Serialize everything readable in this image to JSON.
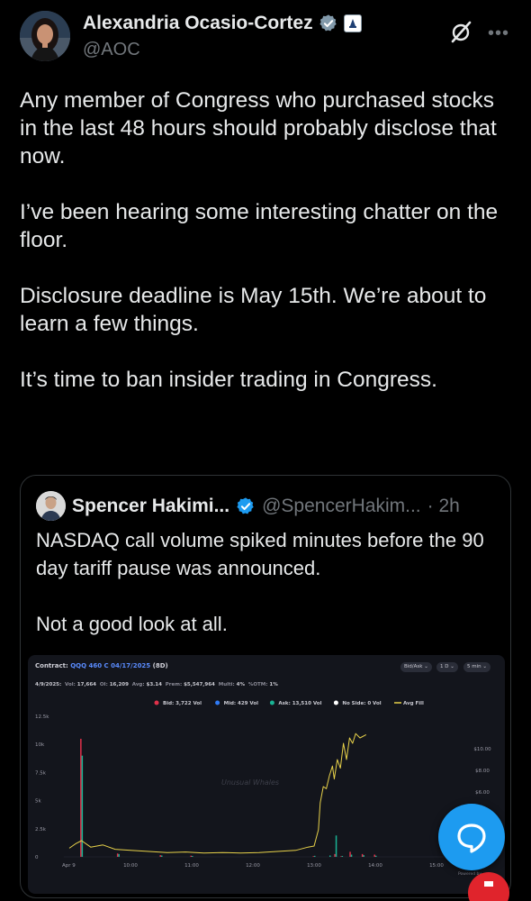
{
  "author": {
    "name": "Alexandria Ocasio-Cortez",
    "handle": "@AOC"
  },
  "tweet": {
    "paragraphs": [
      "Any member of Congress who purchased stocks in the last 48 hours should probably disclose that now.",
      "I’ve been hearing some interesting chatter on the floor.",
      "Disclosure deadline is May 15th. We’re about to learn a few things.",
      "It’s time to ban insider trading in Congress."
    ]
  },
  "quote": {
    "name": "Spencer Hakimi...",
    "handle": "@SpencerHakim...",
    "time": "· 2h",
    "paragraphs": [
      "NASDAQ call volume spiked minutes before the 90 day tariff pause was announced.",
      "Not a good look at all."
    ]
  },
  "chart_header": {
    "contract_label": "Contract:",
    "contract_value": "QQQ 460 C 04/17/2025",
    "contract_days": "(8D)",
    "controls": [
      "Bid/Ask",
      "1 D",
      "5 min"
    ],
    "stats": {
      "date": "4/9/2025:",
      "vol_label": "Vol:",
      "vol": "17,664",
      "oi_label": "OI:",
      "oi": "16,209",
      "avg_label": "Avg:",
      "avg": "$3.14",
      "prem_label": "Prem:",
      "prem": "$5,547,964",
      "multi_label": "Multi:",
      "multi": "4%",
      "otm_label": "%OTM:",
      "otm": "1%"
    },
    "watermark": "Unusual Whales",
    "powered": "Powered by"
  },
  "chart_data": {
    "type": "bar",
    "legend": [
      {
        "label": "Bid:",
        "value": "3,722 Vol",
        "color": "#e0314a"
      },
      {
        "label": "Mid:",
        "value": "429 Vol",
        "color": "#2f7bf6"
      },
      {
        "label": "Ask:",
        "value": "13,510 Vol",
        "color": "#19b394"
      },
      {
        "label": "No Side:",
        "value": "0 Vol",
        "color": "#ffffff"
      },
      {
        "label": "Avg Fill",
        "value": "",
        "color": "#e8d24a"
      }
    ],
    "left_axis": {
      "ticks": [
        "12.5k",
        "10k",
        "7.5k",
        "5k",
        "2.5k",
        "0"
      ],
      "values": [
        12500,
        10000,
        7500,
        5000,
        2500,
        0
      ],
      "ylim": [
        0,
        12500
      ]
    },
    "right_axis": {
      "ticks": [
        "$10.00",
        "$8.00",
        "$6.00"
      ],
      "values": [
        10,
        8,
        6
      ]
    },
    "x_ticks": [
      "Apr 9",
      "10:00",
      "11:00",
      "12:00",
      "13:00",
      "14:00",
      "15:00"
    ],
    "colors": {
      "bid": "#e0314a",
      "ask": "#19b394",
      "line": "#e8d24a"
    },
    "bars": [
      {
        "x": 0.2,
        "bid": 10500,
        "ask": 9000
      },
      {
        "x": 0.8,
        "bid": 300,
        "ask": 250
      },
      {
        "x": 1.5,
        "bid": 150,
        "ask": 120
      },
      {
        "x": 2.0,
        "bid": 100,
        "ask": 80
      },
      {
        "x": 4.0,
        "bid": 60,
        "ask": 90
      },
      {
        "x": 4.25,
        "bid": 0,
        "ask": 120
      },
      {
        "x": 4.35,
        "bid": 250,
        "ask": 1900
      },
      {
        "x": 4.45,
        "bid": 50,
        "ask": 80
      },
      {
        "x": 4.6,
        "bid": 450,
        "ask": 200
      },
      {
        "x": 4.8,
        "bid": 250,
        "ask": 150
      },
      {
        "x": 5.0,
        "bid": 200,
        "ask": 100
      }
    ],
    "line_ylim": [
      0,
      13
    ],
    "line": [
      [
        0.0,
        0.8
      ],
      [
        0.1,
        1.2
      ],
      [
        0.2,
        1.5
      ],
      [
        0.35,
        0.9
      ],
      [
        0.55,
        1.1
      ],
      [
        0.75,
        0.7
      ],
      [
        1.0,
        0.6
      ],
      [
        1.3,
        0.5
      ],
      [
        1.6,
        0.4
      ],
      [
        1.9,
        0.45
      ],
      [
        2.2,
        0.35
      ],
      [
        2.5,
        0.4
      ],
      [
        2.8,
        0.35
      ],
      [
        3.1,
        0.4
      ],
      [
        3.4,
        0.5
      ],
      [
        3.7,
        0.6
      ],
      [
        3.9,
        0.9
      ],
      [
        4.0,
        1.0
      ],
      [
        4.07,
        2.5
      ],
      [
        4.1,
        5.0
      ],
      [
        4.15,
        6.5
      ],
      [
        4.2,
        6.3
      ],
      [
        4.25,
        7.5
      ],
      [
        4.3,
        8.4
      ],
      [
        4.33,
        7.2
      ],
      [
        4.38,
        9.0
      ],
      [
        4.43,
        8.2
      ],
      [
        4.48,
        10.5
      ],
      [
        4.53,
        9.0
      ],
      [
        4.58,
        11.0
      ],
      [
        4.63,
        10.5
      ],
      [
        4.68,
        11.4
      ],
      [
        4.75,
        11.0
      ],
      [
        4.85,
        11.3
      ]
    ]
  }
}
